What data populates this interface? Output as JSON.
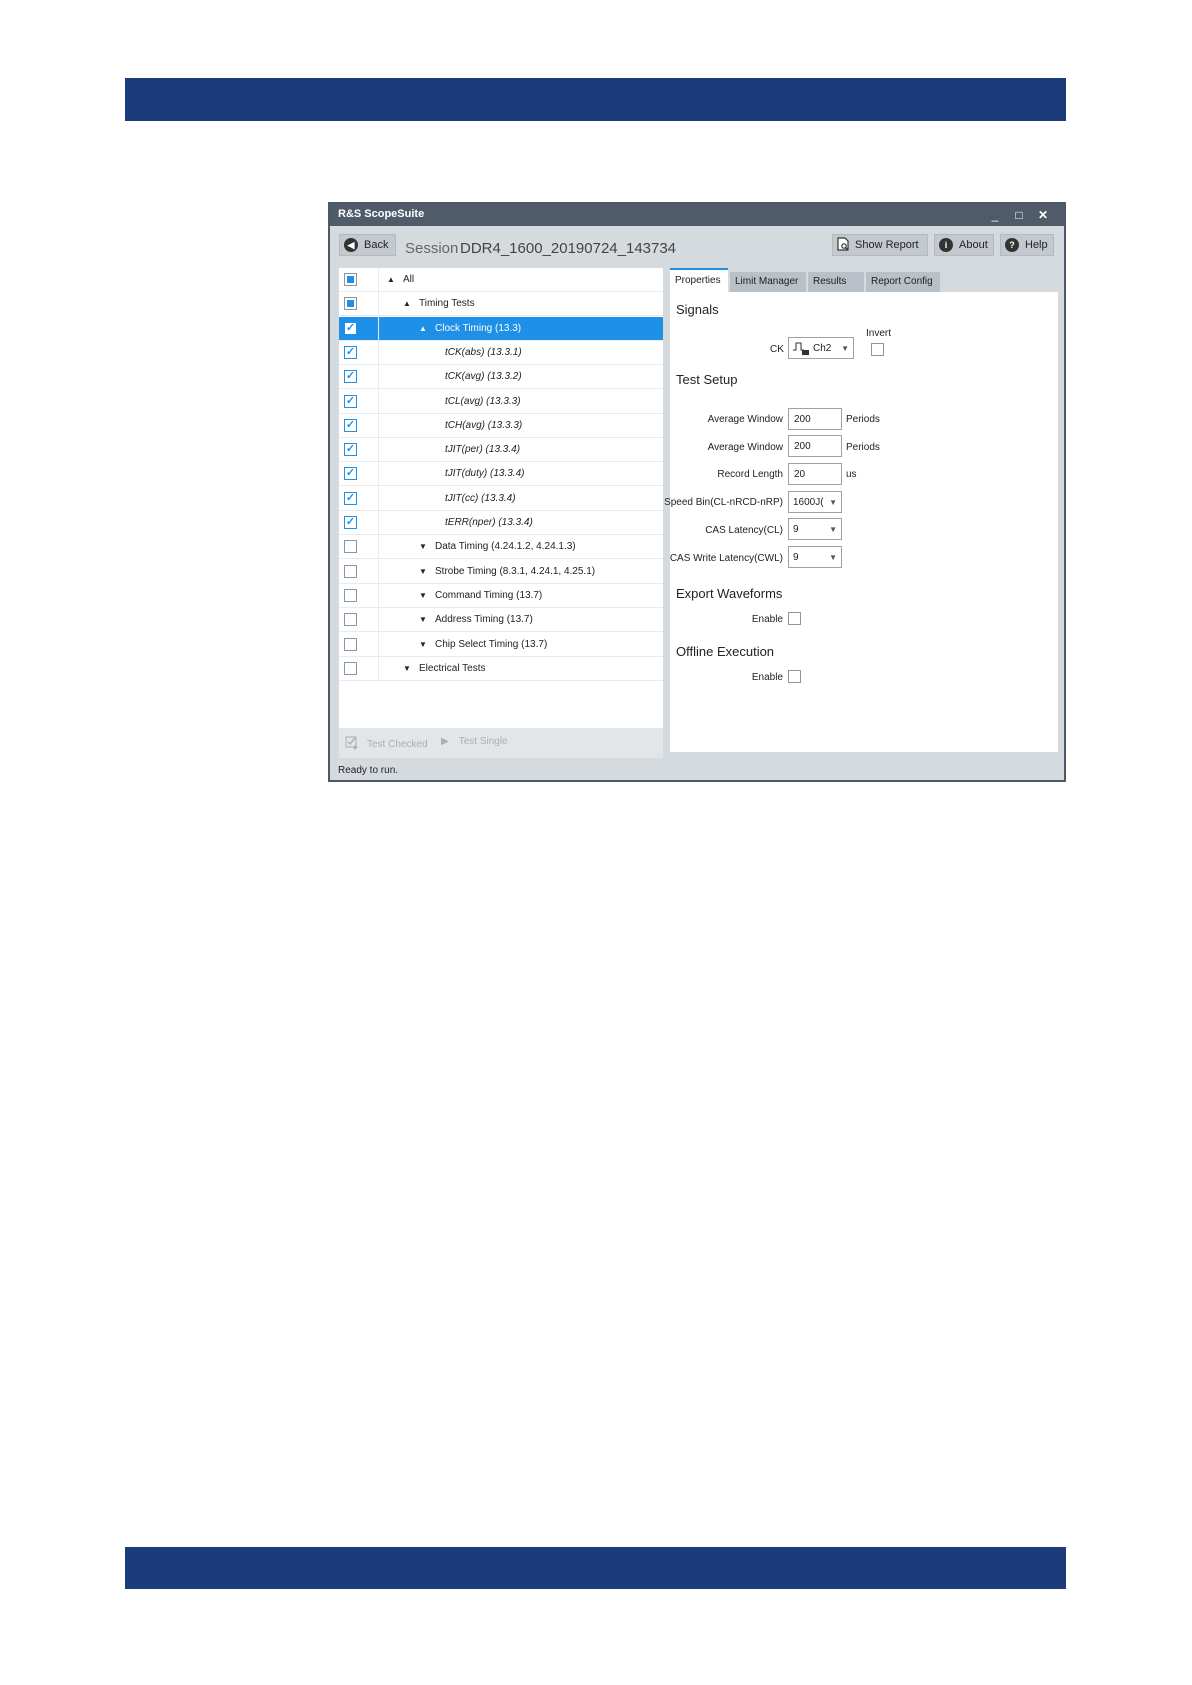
{
  "window": {
    "title": "R&S ScopeSuite",
    "controls": {
      "minimize": "_",
      "maximize": "□",
      "close": "✕"
    }
  },
  "toolbar": {
    "back_label": "Back",
    "session_label": "Session",
    "session_value": "DDR4_1600_20190724_143734",
    "show_report_label": "Show Report",
    "about_label": "About",
    "help_label": "Help"
  },
  "tree": {
    "rows": [
      {
        "label": "All",
        "state": "partial",
        "arrow": "▲"
      },
      {
        "label": "Timing Tests",
        "state": "partial",
        "arrow": "▲"
      },
      {
        "label": "Clock Timing (13.3)",
        "state": "checked",
        "arrow": "▲",
        "selected": true
      },
      {
        "label": "tCK(abs) (13.3.1)",
        "state": "checked",
        "italic": true
      },
      {
        "label": "tCK(avg) (13.3.2)",
        "state": "checked",
        "italic": true
      },
      {
        "label": "tCL(avg) (13.3.3)",
        "state": "checked",
        "italic": true
      },
      {
        "label": "tCH(avg) (13.3.3)",
        "state": "checked",
        "italic": true
      },
      {
        "label": "tJIT(per) (13.3.4)",
        "state": "checked",
        "italic": true
      },
      {
        "label": "tJIT(duty) (13.3.4)",
        "state": "checked",
        "italic": true
      },
      {
        "label": "tJIT(cc) (13.3.4)",
        "state": "checked",
        "italic": true
      },
      {
        "label": "tERR(nper) (13.3.4)",
        "state": "checked",
        "italic": true
      },
      {
        "label": "Data Timing (4.24.1.2, 4.24.1.3)",
        "state": "unchecked",
        "arrow": "▼"
      },
      {
        "label": "Strobe Timing (8.3.1, 4.24.1, 4.25.1)",
        "state": "unchecked",
        "arrow": "▼"
      },
      {
        "label": "Command Timing (13.7)",
        "state": "unchecked",
        "arrow": "▼"
      },
      {
        "label": "Address Timing (13.7)",
        "state": "unchecked",
        "arrow": "▼"
      },
      {
        "label": "Chip Select Timing (13.7)",
        "state": "unchecked",
        "arrow": "▼"
      },
      {
        "label": "Electrical Tests",
        "state": "unchecked",
        "arrow": "▼"
      }
    ],
    "test_checked_label": "Test Checked",
    "test_single_label": "Test Single"
  },
  "tabs": [
    "Properties",
    "Limit Manager",
    "Results",
    "Report Config"
  ],
  "properties": {
    "signals_title": "Signals",
    "ck_label": "CK",
    "ck_channel": "Ch2",
    "invert_label": "Invert",
    "test_setup_title": "Test Setup",
    "avg_window1_label": "Average Window",
    "avg_window1_value": "200",
    "avg_window1_unit": "Periods",
    "avg_window2_label": "Average Window",
    "avg_window2_value": "200",
    "avg_window2_unit": "Periods",
    "record_length_label": "Record Length",
    "record_length_value": "20",
    "record_length_unit": "us",
    "speed_bin_label": "Speed Bin(CL-nRCD-nRP)",
    "speed_bin_value": "1600J(",
    "cas_latency_label": "CAS Latency(CL)",
    "cas_latency_value": "9",
    "cas_write_latency_label": "CAS Write Latency(CWL)",
    "cas_write_latency_value": "9",
    "export_title": "Export Waveforms",
    "export_enable_label": "Enable",
    "offline_title": "Offline Execution",
    "offline_enable_label": "Enable"
  },
  "status": "Ready to run.",
  "colors": {
    "brand_band": "#1b3b7a",
    "selection": "#1e90e8",
    "titlebar": "#4f5b68"
  }
}
